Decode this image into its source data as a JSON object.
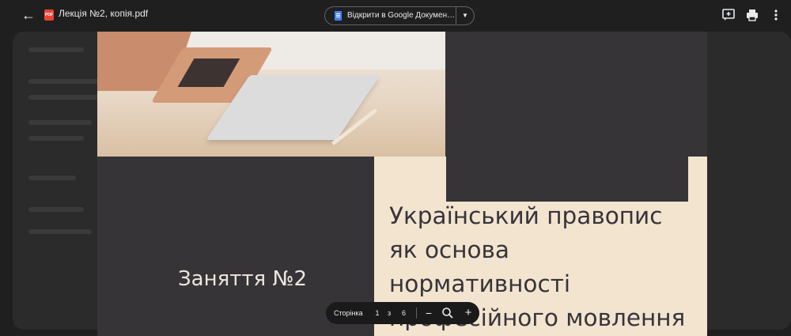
{
  "header": {
    "file_title": "Лекція №2, копія.pdf",
    "pdf_badge": "PDF",
    "open_with_label": "Відкрити в Google Докумен…",
    "icons": [
      "back-arrow-icon",
      "pdf-icon",
      "google-docs-icon",
      "chevron-down-icon",
      "add-comment-icon",
      "print-icon",
      "more-vert-icon"
    ]
  },
  "document": {
    "lecture_label": "Заняття №2",
    "title_lines": [
      "Український правопис",
      "як основа",
      "нормативності",
      "професійного мовлення"
    ]
  },
  "page_controls": {
    "label": "Сторінка",
    "current": "1",
    "of": "з",
    "total": "6",
    "icons": [
      "zoom-out-icon",
      "zoom-icon",
      "zoom-in-icon"
    ]
  },
  "colors": {
    "toolbar_bg": "#1f1f1f",
    "slide_dark": "#373437",
    "slide_cream": "#f2e4cf",
    "pdf_red": "#ea4335",
    "docs_blue": "#4285f4"
  }
}
